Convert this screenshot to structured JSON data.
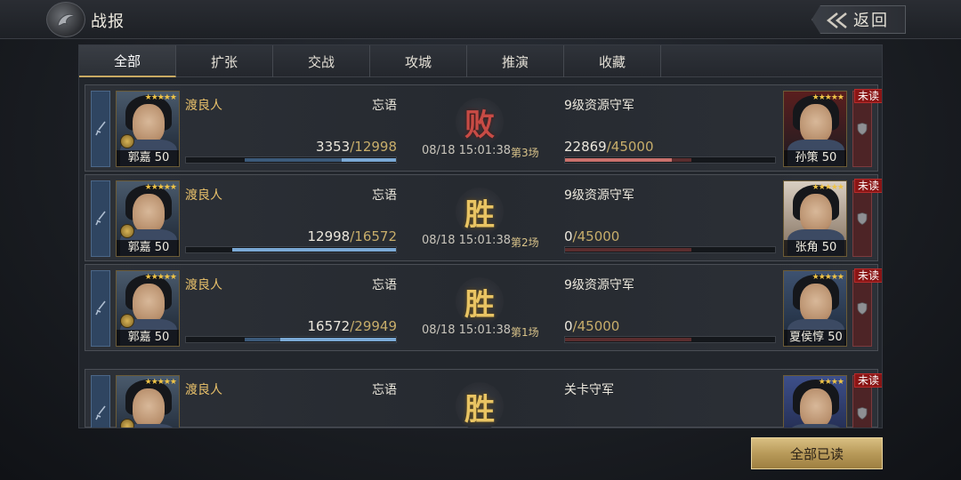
{
  "header": {
    "title": "战报",
    "back_label": "返回"
  },
  "tabs": [
    "全部",
    "扩张",
    "交战",
    "攻城",
    "推演",
    "收藏"
  ],
  "active_tab": 0,
  "reports": [
    {
      "attacker": {
        "player": "渡良人",
        "alliance": "忘语",
        "hero": "郭嘉 50",
        "stars": "★★★★★",
        "troops": "3353",
        "troops_max": "/12998",
        "fill": 0.26
      },
      "result": "败",
      "result_type": "lose",
      "time": "08/18 15:01:38",
      "round": "第3场",
      "defender": {
        "name": "9级资源守军",
        "hero": "孙策 50",
        "stars": "★★★★★",
        "troops": "22869",
        "troops_max": "/45000",
        "fill": 0.51
      },
      "unread": "未读"
    },
    {
      "attacker": {
        "player": "渡良人",
        "alliance": "忘语",
        "hero": "郭嘉 50",
        "stars": "★★★★★",
        "troops": "12998",
        "troops_max": "/16572",
        "fill": 0.78
      },
      "result": "胜",
      "result_type": "win",
      "time": "08/18 15:01:38",
      "round": "第2场",
      "defender": {
        "name": "9级资源守军",
        "hero": "张角 50",
        "stars": "★★★★★",
        "troops": "0",
        "troops_max": "/45000",
        "fill": 0
      },
      "unread": "未读"
    },
    {
      "attacker": {
        "player": "渡良人",
        "alliance": "忘语",
        "hero": "郭嘉 50",
        "stars": "★★★★★",
        "troops": "16572",
        "troops_max": "/29949",
        "fill": 0.55
      },
      "result": "胜",
      "result_type": "win",
      "time": "08/18 15:01:38",
      "round": "第1场",
      "defender": {
        "name": "9级资源守军",
        "hero": "夏侯惇 50",
        "stars": "★★★★★",
        "troops": "0",
        "troops_max": "/45000",
        "fill": 0
      },
      "unread": "未读"
    },
    {
      "attacker": {
        "player": "渡良人",
        "alliance": "忘语",
        "hero": "",
        "stars": "★★★★★",
        "troops": "",
        "troops_max": "",
        "fill": 0
      },
      "result": "胜",
      "result_type": "win",
      "time": "",
      "round": "",
      "defender": {
        "name": "关卡守军",
        "hero": "",
        "stars": "★★★★",
        "troops": "",
        "troops_max": "",
        "fill": 0
      },
      "unread": "未读"
    }
  ],
  "footer": {
    "read_all_label": "全部已读"
  },
  "colors": {
    "accent_gold": "#c8a962",
    "win": "#e9c463",
    "lose": "#c84b45",
    "attacker_bar": "#7aa8d4",
    "defender_bar": "#c9716d",
    "unread_badge": "#8a1515"
  },
  "icons": {
    "title_emblem": "dragon-emblem-icon",
    "back": "double-chevron-left-icon",
    "attacker_side": "sword-icon",
    "defender_side": "shield-icon"
  }
}
